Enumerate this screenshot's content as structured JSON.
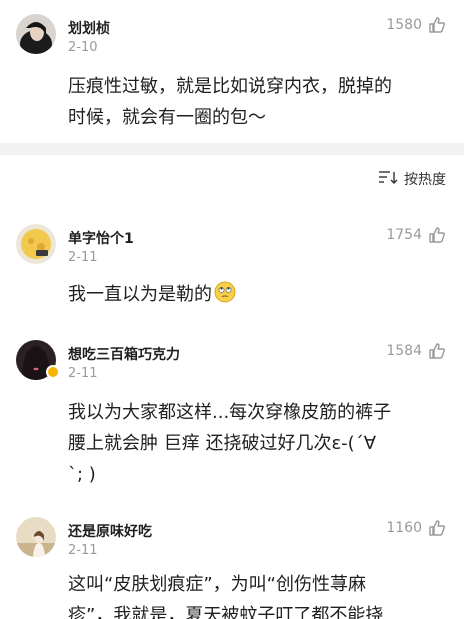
{
  "comments": [
    {
      "name": "划划桢",
      "date": "2-10",
      "likes": "1580",
      "text_lines": [
        "压痕性过敏，就是比如说穿内衣，脱掉的",
        "时候，就会有一圈的包～"
      ]
    },
    {
      "name": "单字怡个1",
      "date": "2-11",
      "likes": "1754",
      "text_lines": [
        "我一直以为是勒的"
      ],
      "emoji": "rolling-eyes-emoji"
    },
    {
      "name": "想吃三百箱巧克力",
      "date": "2-11",
      "likes": "1584",
      "text_lines": [
        "我以为大家都这样...每次穿橡皮筋的裤子",
        "腰上就会肿 巨痒 还挠破过好几次ε-(´∀",
        "`; )"
      ],
      "badge": "verified-badge"
    },
    {
      "name": "还是原味好吃",
      "date": "2-11",
      "likes": "1160",
      "text_lines": [
        "这叫“皮肤划痕症”，为叫“创伤性荨麻",
        "疹”，我就是，夏天被蚊子叮了都不能挠"
      ]
    }
  ],
  "sort": {
    "label": "按热度",
    "icon": "sort-icon"
  },
  "colors": {
    "text": "#1f1f1f",
    "meta": "#9a9a9a",
    "divider": "#f2f2f2",
    "badge": "#f5b400"
  }
}
